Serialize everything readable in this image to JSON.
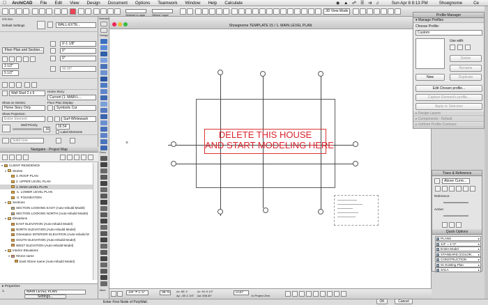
{
  "menubar": {
    "apple": "",
    "app_name": "ArchiCAD",
    "items": [
      "File",
      "Edit",
      "View",
      "Design",
      "Document",
      "Options",
      "Teamwork",
      "Window",
      "Help",
      "Calculate"
    ],
    "clock": "Sun Apr 8  8:13 PM",
    "user": "Shoegnome",
    "extra": "Ce"
  },
  "toolbar": {
    "selectors_layer": "Selector's Layer",
    "others_layer": "Others' Layer",
    "view_mode": "3D View Mode",
    "info_box_label": "Info Box",
    "selection_label": "Selection"
  },
  "infobox": {
    "default_settings": "Default Settings",
    "wall_type": "WALL-EXTE...",
    "floor_plan_section": "Floor Plan and Section...",
    "height_top": "9'-1 1/8\"",
    "height_base": "0\"",
    "offset": "0\"",
    "thickness_a": "3 1/2\"",
    "thickness_b": "5 1/2\"",
    "angle": "90.00°",
    "composite": "Wall Stud 2 x 6",
    "home_story_label": "Home Story:",
    "home_story": "Current (1. MAIN L...",
    "show_on_stories_label": "Show on Stories:",
    "show_on_stories": "Home Story Only",
    "floor_plan_display_label": "Floor Plan Display:",
    "floor_plan_display": "Symbolic Cut",
    "show_projection_label": "Show Projection:",
    "show_projection": "Entire Element",
    "surface": "Surf-Whitewash",
    "wall_priority_label": "Wall Priority",
    "wall_priority": "16",
    "priority_value": "16.54",
    "label_elements": "Label Elements",
    "pen": "110",
    "line_type": "Solid Line"
  },
  "navigator": {
    "title": "Navigator - Project Map",
    "tree": [
      {
        "label": "CLIENT RESIDENCE",
        "level": 0,
        "icon": "project",
        "twisty": "▾"
      },
      {
        "label": "Stories",
        "level": 1,
        "icon": "folder",
        "twisty": "▾"
      },
      {
        "label": "3. ROOF PLAN",
        "level": 2,
        "icon": "story",
        "twisty": ""
      },
      {
        "label": "2. UPPER LEVEL PLAN",
        "level": 2,
        "icon": "story",
        "twisty": ""
      },
      {
        "label": "1. MAIN LEVEL PLAN",
        "level": 2,
        "icon": "story",
        "twisty": "",
        "selected": true
      },
      {
        "label": "-1. LOWER LEVEL PLAN",
        "level": 2,
        "icon": "story",
        "twisty": ""
      },
      {
        "label": "-2. FOUNDATION",
        "level": 2,
        "icon": "story",
        "twisty": ""
      },
      {
        "label": "Sections",
        "level": 1,
        "icon": "folder",
        "twisty": "▾"
      },
      {
        "label": "SECTION LOOKING EAST (Auto-rebuild Model)",
        "level": 2,
        "icon": "section",
        "twisty": ""
      },
      {
        "label": "SECTION LOOKING NORTH (Auto-rebuild Model)",
        "level": 2,
        "icon": "section",
        "twisty": ""
      },
      {
        "label": "Elevations",
        "level": 1,
        "icon": "folder",
        "twisty": "▾"
      },
      {
        "label": "EAST ELEVATION (Auto-rebuild Model)",
        "level": 2,
        "icon": "elevation",
        "twisty": ""
      },
      {
        "label": "NORTH ELEVATION (Auto-rebuild Model)",
        "level": 2,
        "icon": "elevation",
        "twisty": ""
      },
      {
        "label": "Orientation INTERIOR ELEVATION (Auto-rebuild M",
        "level": 2,
        "icon": "elevation",
        "twisty": ""
      },
      {
        "label": "SOUTH ELEVATION (Auto-rebuild Model)",
        "level": 2,
        "icon": "elevation",
        "twisty": ""
      },
      {
        "label": "WEST ELEVATION (Auto-rebuild Model)",
        "level": 2,
        "icon": "elevation",
        "twisty": ""
      },
      {
        "label": "Interior Elevations",
        "level": 1,
        "icon": "folder",
        "twisty": "▾"
      },
      {
        "label": "#Zone name",
        "level": 2,
        "icon": "zone",
        "twisty": "▾"
      },
      {
        "label": "East #Zone name (Auto-rebuild Model)",
        "level": 3,
        "icon": "elevation",
        "twisty": ""
      }
    ]
  },
  "properties": {
    "title": "Properties",
    "story": "MAIN LEVEL PLAN",
    "story_num": "1.",
    "settings_button": "Settings..."
  },
  "toolbox": {
    "design_label": "Design",
    "document_label": "Docu",
    "more_label": "More"
  },
  "canvas": {
    "title": "Shoegnome TEMPLATE 15 / 1. MAIN LEVEL PLAN",
    "message_line1": "DELETE THIS HOUSE",
    "message_line2": "AND START MODELING HERE",
    "message_color": "#d8242c"
  },
  "statusbar": {
    "scale": "1/4\"  =  1'-0\"",
    "zoom": "98 %",
    "angle": "0.00°",
    "coord_dx": "Δx: 85'-1\"",
    "coord_dy": "Δy: -35'-1 1/4\"",
    "coord_r": "Δr: 94'-9 1/2\"",
    "coord_a": "Δa: 336.40°",
    "project_zero": "to Project Zero",
    "ok": "OK",
    "cancel": "Cancel"
  },
  "bottombar": {
    "prompt": "Enter First Node of PolyWall."
  },
  "profile_manager": {
    "title": "Profile Manager",
    "manage_profiles": "Manage Profiles",
    "choose_profile_label": "Choose Profile:",
    "choose_profile_value": "Custom",
    "use_with_label": "Use with:",
    "new_button": "New",
    "delete_button": "Delete",
    "rename_button": "Rename",
    "duplicate_button": "Duplicate",
    "edit_chosen_button": "Edit Chosen profile...",
    "capture_button": "Capture Element's profile...",
    "apply_button": "Apply to Selection",
    "design_layers": "Design Layers",
    "components": "Components - Default",
    "uniform_contours": "Uniform Profile Contours"
  },
  "trace_panel": {
    "title": "Trace & Reference",
    "above_current": "Above Curre...",
    "reference_label": "Reference:",
    "active_label": "Active:",
    "quick_options_title": "Quick Options",
    "quick_options": [
      "PLANS",
      "1/4\"  =  1'-0\"",
      "Entire Model",
      "STANDARD (COLOR...",
      "CONSTRUCTION",
      "01 Existing Plan",
      "SALA"
    ]
  }
}
